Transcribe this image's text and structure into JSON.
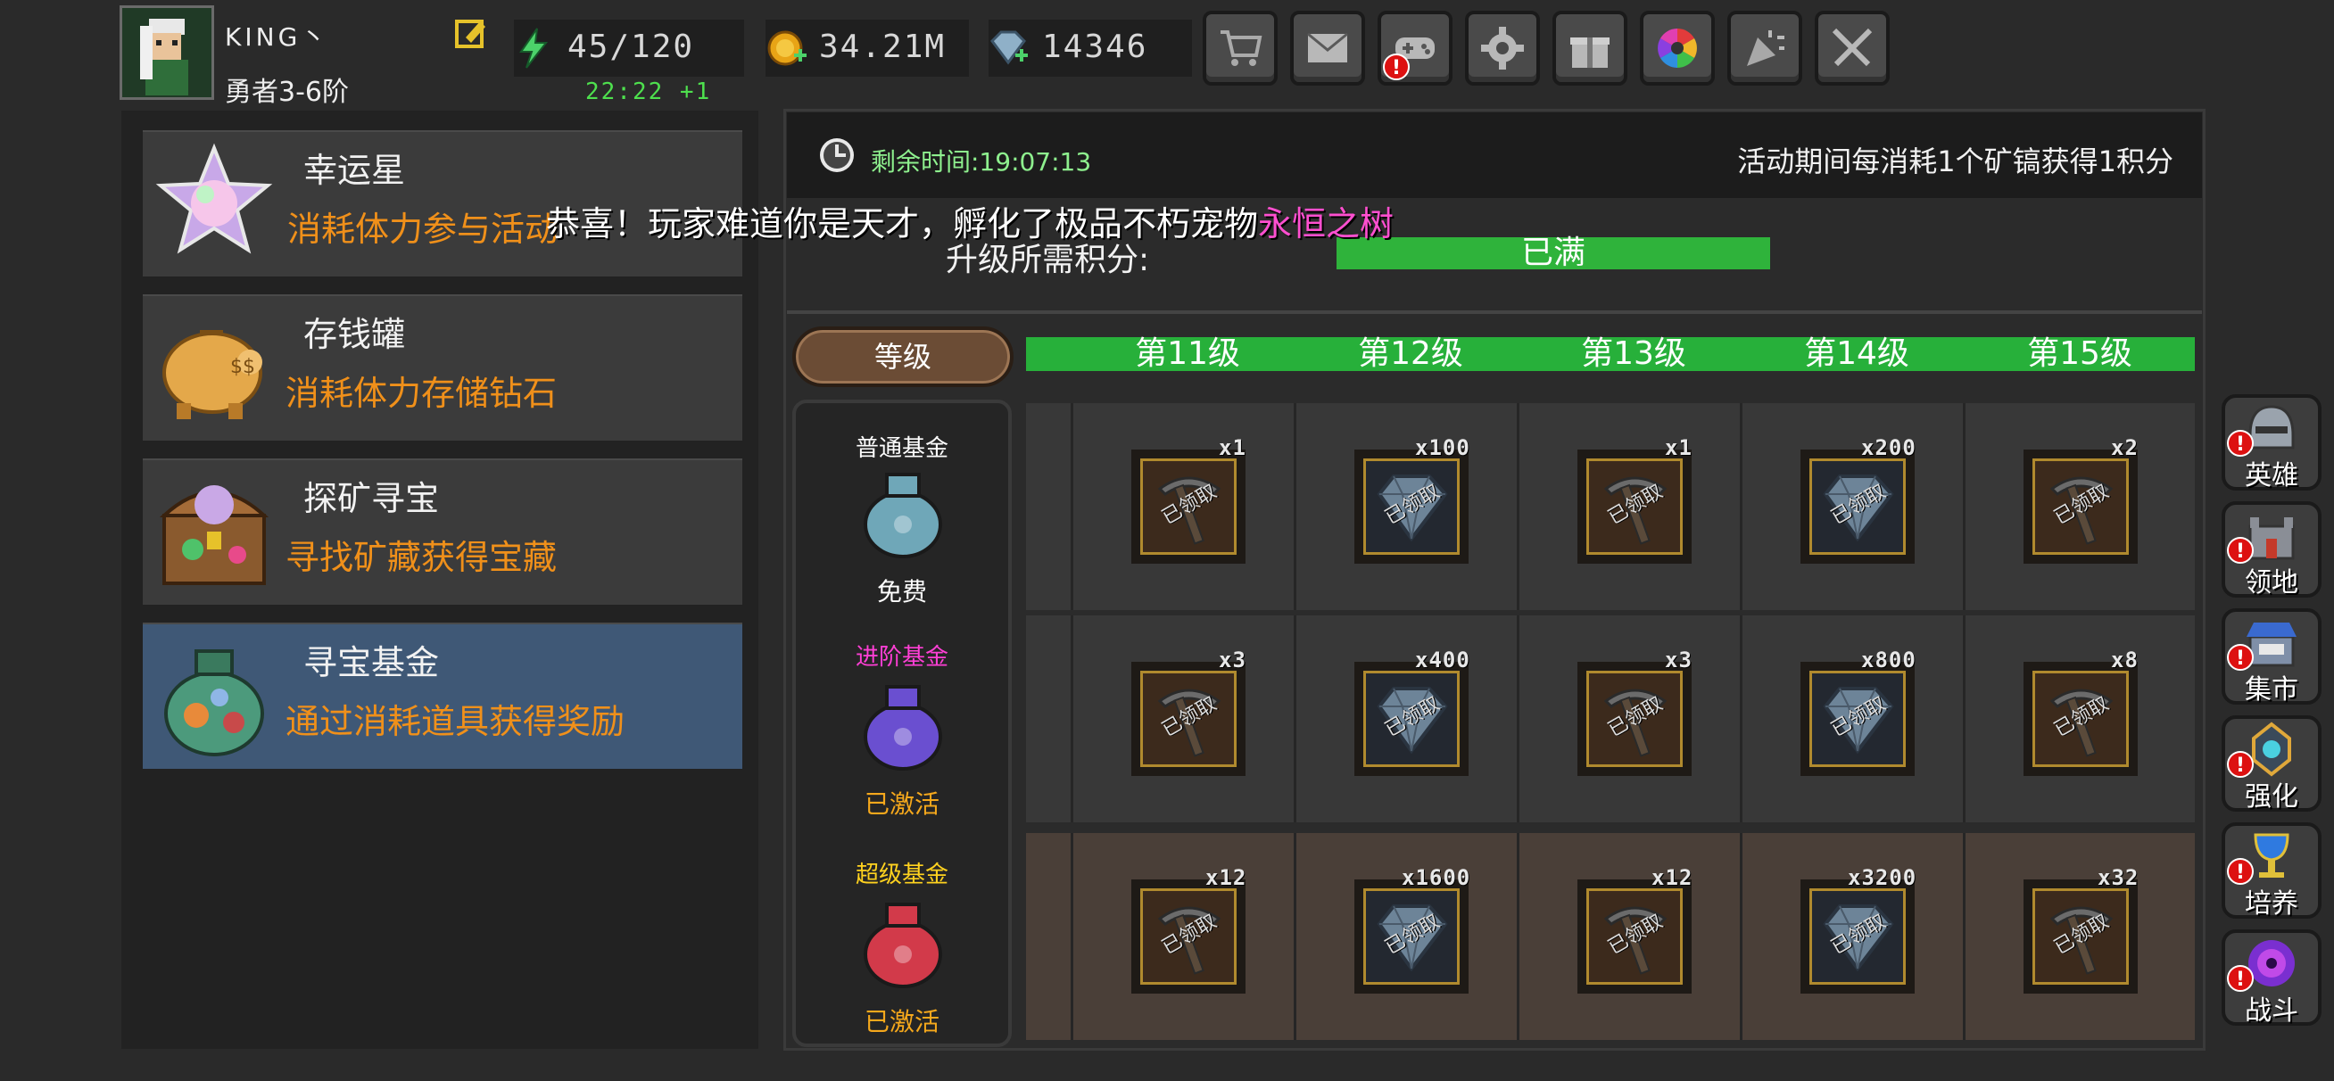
{
  "header": {
    "username": "KING丶",
    "rank": "勇者3-6阶",
    "energy": "45/120",
    "energy_timer": "22:22 +1",
    "gold": "34.21M",
    "diamonds": "14346",
    "top_buttons": [
      "cart-icon",
      "mail-icon",
      "gamepad-icon",
      "gear-icon",
      "gift-icon",
      "color-wheel-icon",
      "party-popper-icon",
      "crossed-swords-icon"
    ]
  },
  "activities": [
    {
      "title": "幸运星",
      "desc": "消耗体力参与活动",
      "icon": "lucky-star-icon"
    },
    {
      "title": "存钱罐",
      "desc": "消耗体力存储钻石",
      "icon": "piggy-bank-icon"
    },
    {
      "title": "探矿寻宝",
      "desc": "寻找矿藏获得宝藏",
      "icon": "treasure-chest-icon"
    },
    {
      "title": "寻宝基金",
      "desc": "通过消耗道具获得奖励",
      "icon": "fund-bag-icon",
      "selected": true
    }
  ],
  "event": {
    "remaining_label": "剩余时间:19:07:13",
    "rule": "活动期间每消耗1个矿镐获得1积分",
    "broadcast_prefix": "恭喜！玩家难道你是天才，孵化了极品不朽宠物",
    "broadcast_highlight": "永恒之树",
    "upgrade_label": "升级所需积分:",
    "upgrade_status": "已满"
  },
  "grid": {
    "level_tab": "等级",
    "levels": [
      "第11级",
      "第12级",
      "第13级",
      "第14级",
      "第15级"
    ],
    "claimed_text": "已领取",
    "funds": [
      {
        "name": "普通基金",
        "state": "免费",
        "name_color": "#ffffff",
        "state_color": "#ffffff",
        "bag": "#6fa7b8",
        "rewards": [
          {
            "type": "pickaxe",
            "qty": "x1"
          },
          {
            "type": "gem",
            "qty": "x100"
          },
          {
            "type": "pickaxe",
            "qty": "x1"
          },
          {
            "type": "gem",
            "qty": "x200"
          },
          {
            "type": "pickaxe",
            "qty": "x2"
          }
        ]
      },
      {
        "name": "进阶基金",
        "state": "已激活",
        "name_color": "#ff3fd5",
        "state_color": "#f5a81c",
        "bag": "#6a4fd0",
        "rewards": [
          {
            "type": "pickaxe",
            "qty": "x3"
          },
          {
            "type": "gem",
            "qty": "x400"
          },
          {
            "type": "pickaxe",
            "qty": "x3"
          },
          {
            "type": "gem",
            "qty": "x800"
          },
          {
            "type": "pickaxe",
            "qty": "x8"
          }
        ]
      },
      {
        "name": "超级基金",
        "state": "已激活",
        "name_color": "#ffd21f",
        "state_color": "#f5a81c",
        "bag": "#d23a4a",
        "rewards": [
          {
            "type": "pickaxe",
            "qty": "x12"
          },
          {
            "type": "gem",
            "qty": "x1600"
          },
          {
            "type": "pickaxe",
            "qty": "x12"
          },
          {
            "type": "gem",
            "qty": "x3200"
          },
          {
            "type": "pickaxe",
            "qty": "x32"
          }
        ]
      }
    ]
  },
  "side_nav": [
    {
      "label": "英雄",
      "icon": "helmet-icon"
    },
    {
      "label": "领地",
      "icon": "castle-icon"
    },
    {
      "label": "集市",
      "icon": "market-icon"
    },
    {
      "label": "强化",
      "icon": "enhance-icon"
    },
    {
      "label": "培养",
      "icon": "chalice-icon"
    },
    {
      "label": "战斗",
      "icon": "portal-icon"
    }
  ],
  "colors": {
    "accent_green": "#27b03a",
    "selected_row": "#3f5876",
    "orange_text": "#f0901a"
  }
}
